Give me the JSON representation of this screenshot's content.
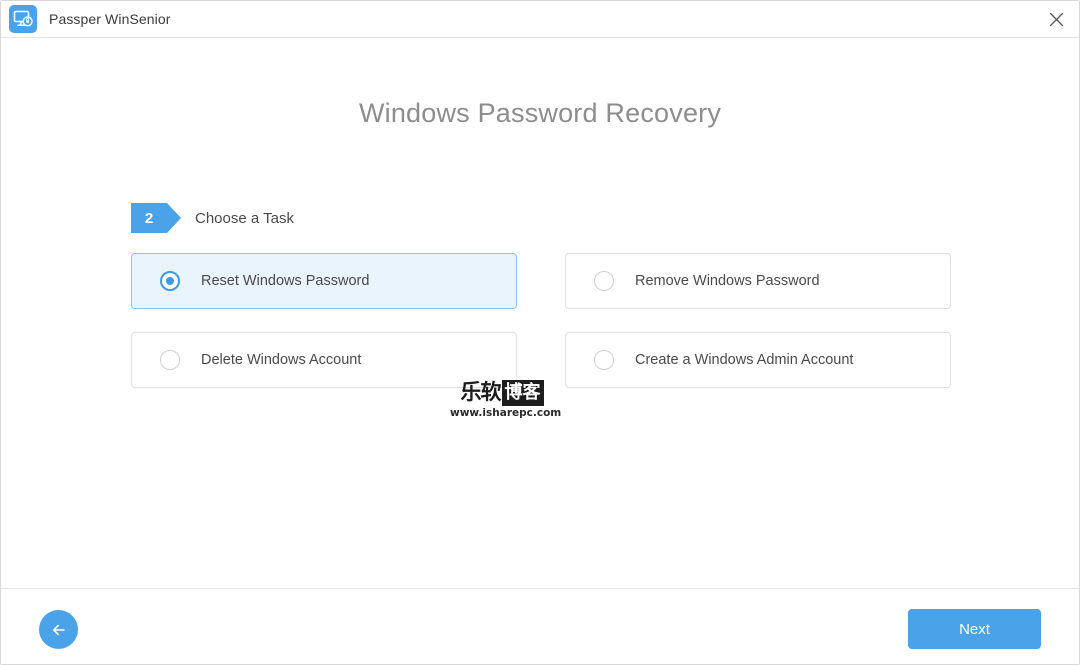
{
  "window": {
    "app_title": "Passper WinSenior",
    "app_icon": "monitor-lock-icon",
    "close_icon": "close-icon"
  },
  "page": {
    "title": "Windows Password Recovery"
  },
  "step": {
    "number": "2",
    "label": "Choose a Task"
  },
  "tasks": [
    {
      "label": "Reset Windows Password",
      "selected": true
    },
    {
      "label": "Remove Windows Password",
      "selected": false
    },
    {
      "label": "Delete Windows Account",
      "selected": false
    },
    {
      "label": "Create a Windows Admin Account",
      "selected": false
    }
  ],
  "watermark": {
    "text_plain": "乐软",
    "text_boxed": "博客",
    "url": "www.isharepc.com"
  },
  "footer": {
    "back_icon": "arrow-left-icon",
    "next_label": "Next"
  },
  "colors": {
    "accent": "#4aa3e8",
    "accent_dark": "#3d9ae3",
    "selected_card_bg": "#eaf4fd",
    "selected_card_border": "#8dc6ef",
    "card_border": "#e0e0e0",
    "title_text": "#8d8d8d",
    "body_text": "#4a4a4a"
  }
}
